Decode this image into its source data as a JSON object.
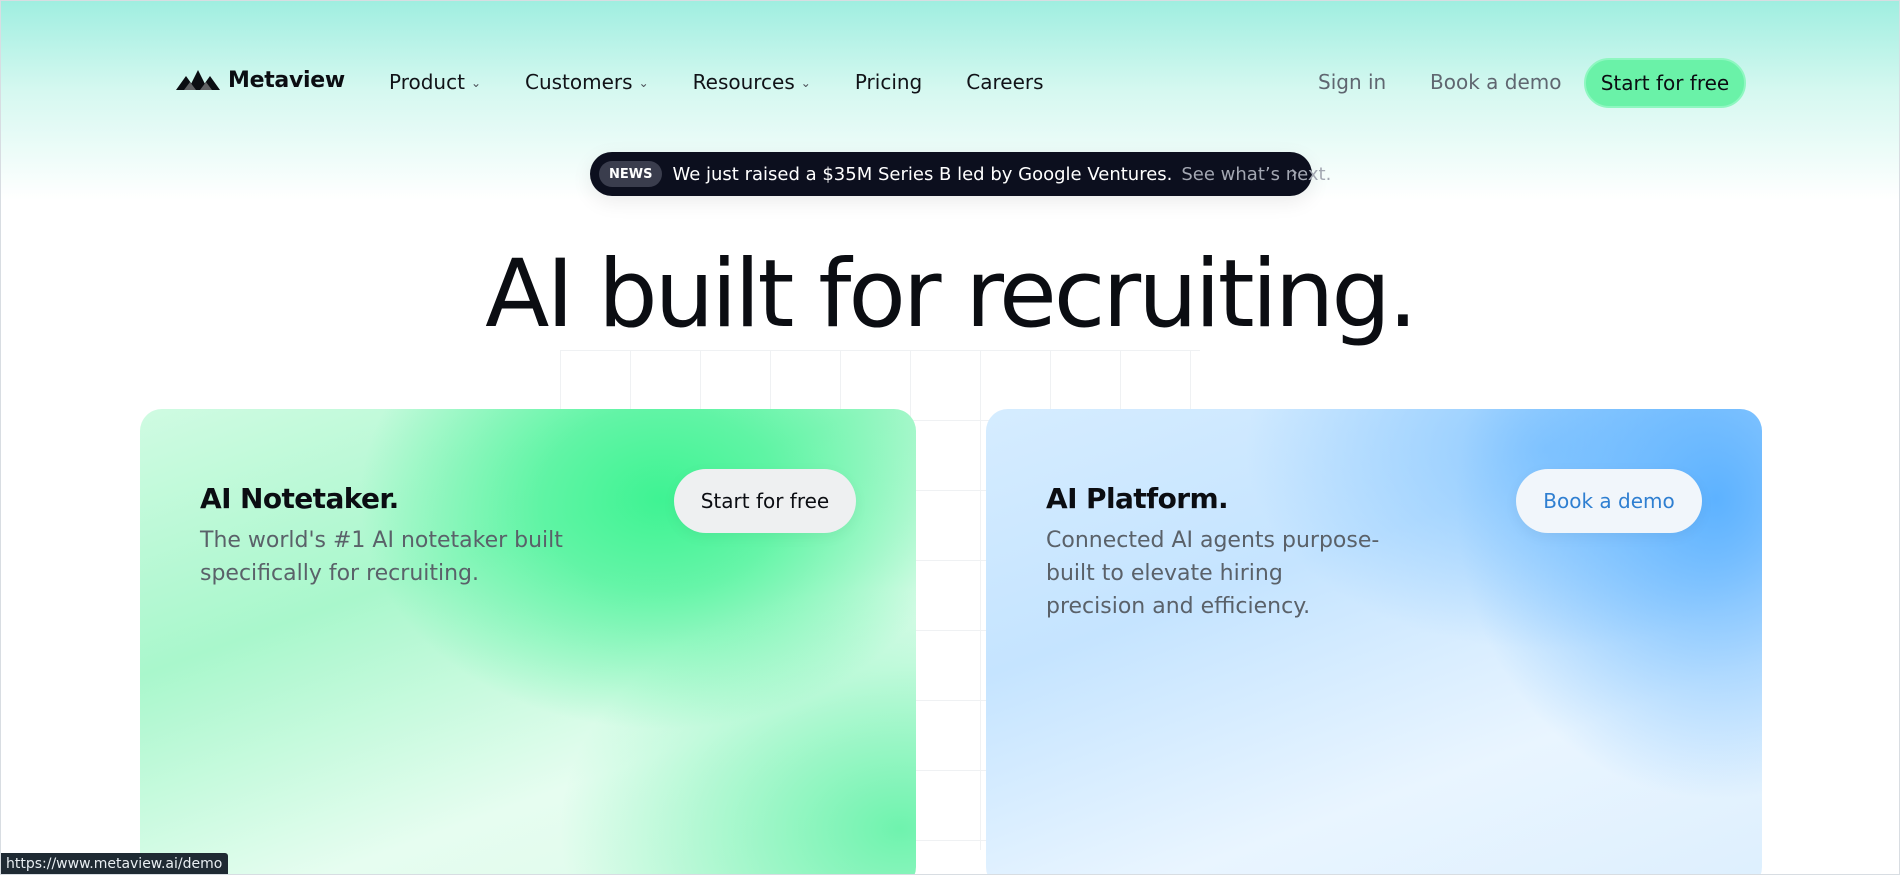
{
  "nav": {
    "brand": "Metaview",
    "links": [
      {
        "label": "Product",
        "dropdown": true
      },
      {
        "label": "Customers",
        "dropdown": true
      },
      {
        "label": "Resources",
        "dropdown": true
      },
      {
        "label": "Pricing",
        "dropdown": false
      },
      {
        "label": "Careers",
        "dropdown": false
      }
    ],
    "sign_in": "Sign in",
    "book_demo": "Book a demo",
    "start_free": "Start for free"
  },
  "news": {
    "badge": "NEWS",
    "text": "We just raised a $35M Series B led by Google Ventures.",
    "more": "See what’s next.",
    "arrow": "›"
  },
  "hero": {
    "title": "AI built for recruiting."
  },
  "cards": [
    {
      "title": "AI Notetaker.",
      "description": "The world's #1 AI notetaker built specifically for recruiting.",
      "button": "Start for free"
    },
    {
      "title": "AI Platform.",
      "description": "Connected AI agents purpose-built to elevate hiring precision and efficiency.",
      "button": "Book a demo"
    }
  ],
  "status_bar": {
    "url": "https://www.metaview.ai/demo"
  },
  "colors": {
    "accent_green": "#6af2a8",
    "news_bg": "#0c0f1e",
    "link_blue": "#2f7fd1"
  },
  "icons": {
    "logo": "metaview-logo-icon",
    "dropdown": "chevron-down-icon",
    "arrow": "chevron-right-icon"
  }
}
